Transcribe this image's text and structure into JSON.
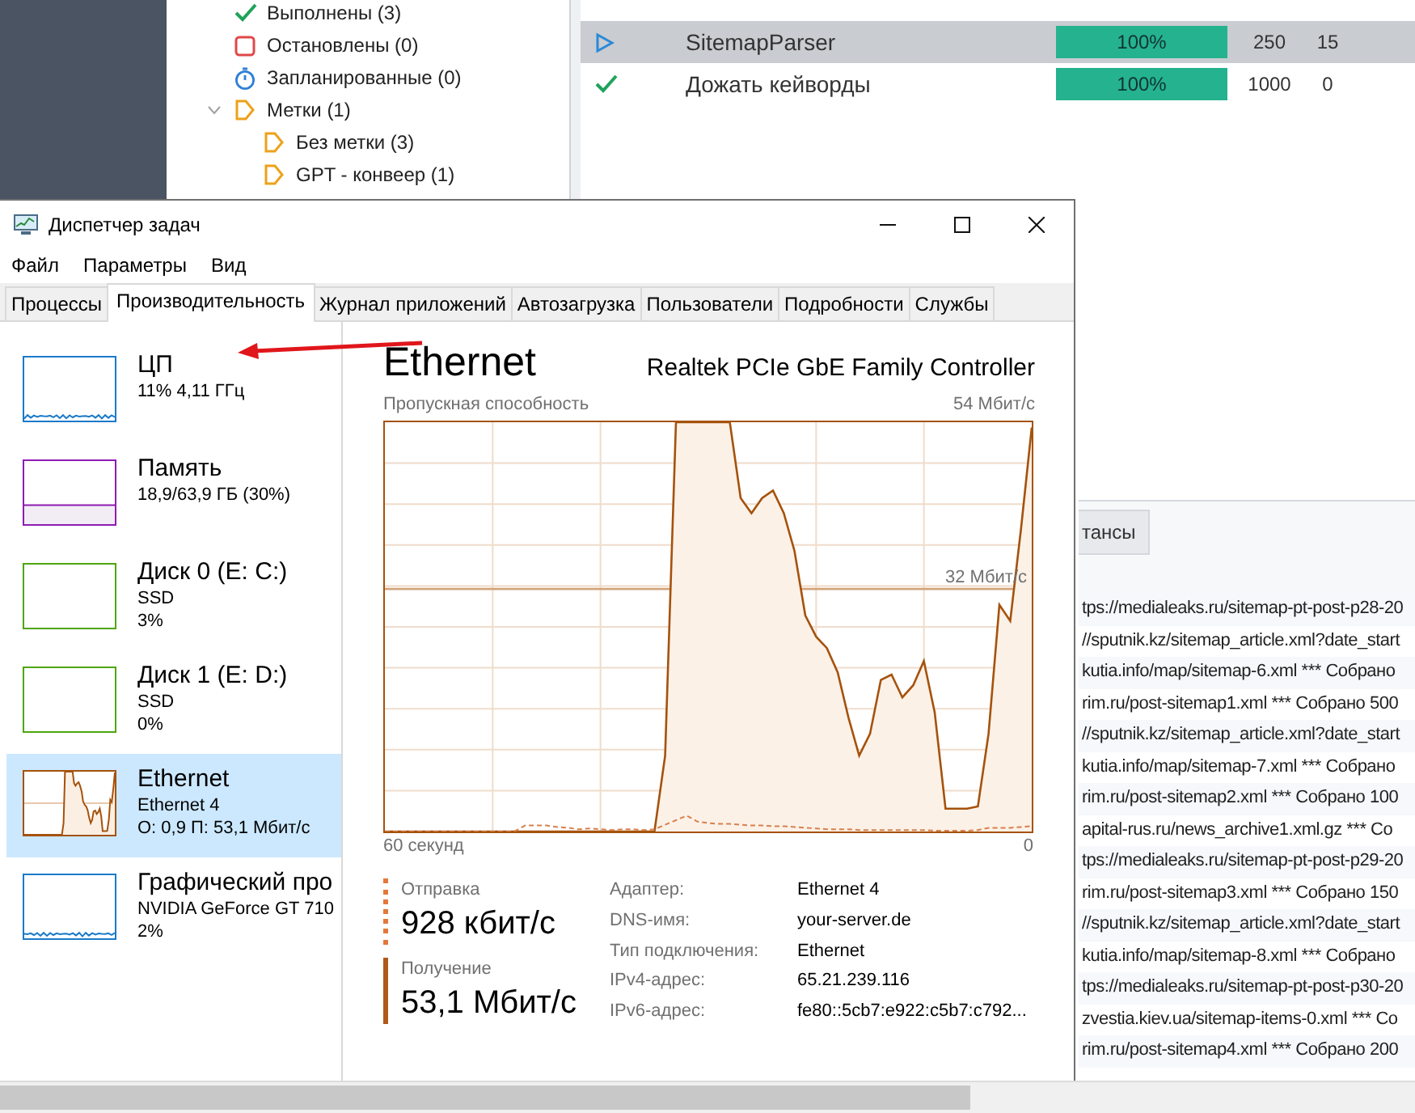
{
  "background_app": {
    "tree": [
      {
        "kind": "done",
        "label": "Выполнены (3)"
      },
      {
        "kind": "stopped",
        "label": "Остановлены (0)"
      },
      {
        "kind": "scheduled",
        "label": "Запланированные (0)"
      },
      {
        "kind": "tag",
        "label": "Метки (1)",
        "expanded": true,
        "children": [
          {
            "kind": "tag",
            "label": "Без метки (3)"
          },
          {
            "kind": "tag",
            "label": "GPT - конвеер (1)"
          }
        ]
      }
    ],
    "tasks": [
      {
        "kind": "running",
        "name": "SitemapParser",
        "progress": "100%",
        "level": 1,
        "column_4": "250",
        "column_5": "15",
        "selected": true
      },
      {
        "kind": "done",
        "name": "Дожать кейворды",
        "progress": "100%",
        "level": 1,
        "column_4": "1000",
        "column_5": "0",
        "selected": false
      }
    ],
    "log_tab": "тансы",
    "log_lines": [
      "tps://medialeaks.ru/sitemap-pt-post-p28-20",
      "//sputnik.kz/sitemap_article.xml?date_start",
      "kutia.info/map/sitemap-6.xml *** Собрано",
      "rim.ru/post-sitemap1.xml *** Собрано 500",
      "//sputnik.kz/sitemap_article.xml?date_start",
      "kutia.info/map/sitemap-7.xml *** Собрано",
      "rim.ru/post-sitemap2.xml *** Собрано 100",
      "apital-rus.ru/news_archive1.xml.gz *** Со",
      "tps://medialeaks.ru/sitemap-pt-post-p29-20",
      "rim.ru/post-sitemap3.xml *** Собрано 150",
      "//sputnik.kz/sitemap_article.xml?date_start",
      "kutia.info/map/sitemap-8.xml *** Собрано",
      "tps://medialeaks.ru/sitemap-pt-post-p30-20",
      "zvestia.kiev.ua/sitemap-items-0.xml *** Co",
      "rim.ru/post-sitemap4.xml *** Собрано 200"
    ]
  },
  "task_manager": {
    "title": "Диспетчер задач",
    "menu": [
      "Файл",
      "Параметры",
      "Вид"
    ],
    "tabs": [
      {
        "label": "Процессы",
        "selected": false
      },
      {
        "label": "Производительность",
        "selected": true
      },
      {
        "label": "Журнал приложений",
        "selected": false
      },
      {
        "label": "Автозагрузка",
        "selected": false
      },
      {
        "label": "Пользователи",
        "selected": false
      },
      {
        "label": "Подробности",
        "selected": false
      },
      {
        "label": "Службы",
        "selected": false
      }
    ],
    "resources": [
      {
        "kind": "cpu",
        "name": "ЦП",
        "details": [
          "11% 4,11 ГГц"
        ],
        "color": "#1a7ac8",
        "selected": false
      },
      {
        "kind": "memory",
        "name": "Память",
        "details": [
          "18,9/63,9 ГБ (30%)"
        ],
        "color": "#8e1cb0",
        "selected": false
      },
      {
        "kind": "disk",
        "name": "Диск 0 (E: C:)",
        "details": [
          "SSD",
          "3%"
        ],
        "color": "#4ea50f",
        "selected": false
      },
      {
        "kind": "disk",
        "name": "Диск 1 (E: D:)",
        "details": [
          "SSD",
          "0%"
        ],
        "color": "#4ea50f",
        "selected": false
      },
      {
        "kind": "network",
        "name": "Ethernet",
        "details": [
          "Ethernet 4",
          "О: 0,9 П: 53,1 Мбит/с"
        ],
        "color": "#a5520c",
        "selected": true
      },
      {
        "kind": "gpu",
        "name": "Графический про",
        "details": [
          "NVIDIA GeForce GT 710",
          "2%"
        ],
        "color": "#1a7ac8",
        "selected": false
      }
    ],
    "detail": {
      "title": "Ethernet",
      "device": "Realtek PCIe GbE Family Controller",
      "graph": {
        "caption": "Пропускная способность",
        "max_label": "54 Мбит/с",
        "line_label": "32 Мбит/с",
        "start_label": "60 секунд",
        "end_label": "0"
      },
      "stats": [
        {
          "kind": "send",
          "label": "Отправка",
          "value": "928 кбит/с"
        },
        {
          "kind": "receive",
          "label": "Получение",
          "value": "53,1 Мбит/с"
        }
      ],
      "properties": [
        {
          "label": "Адаптер:",
          "value": "Ethernet 4"
        },
        {
          "label": "DNS-имя:",
          "value": "your-server.de"
        },
        {
          "label": "Тип подключения:",
          "value": "Ethernet"
        },
        {
          "label": "IPv4-адрес:",
          "value": "65.21.239.116"
        },
        {
          "label": "IPv6-адрес:",
          "value": "fe80::5cb7:e922:c5b7:c792..."
        }
      ]
    }
  }
}
